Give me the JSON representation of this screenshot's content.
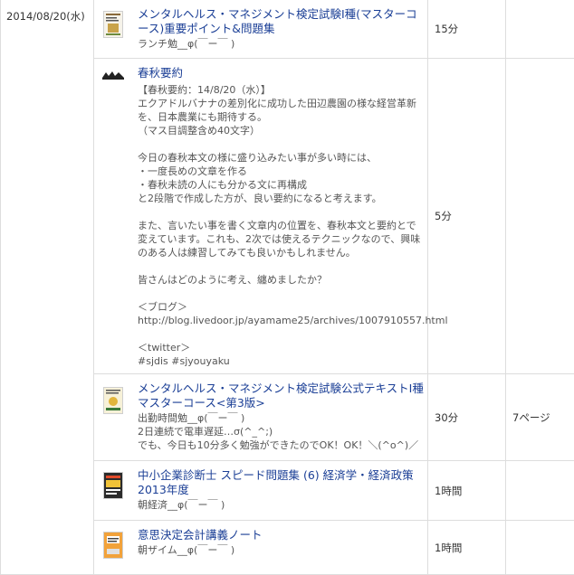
{
  "date": "2014/08/20(水)",
  "rows": [
    {
      "title": "メンタルヘルス・マネジメント検定試験Ⅰ種(マスターコース)重要ポイント&問題集",
      "memo": "ランチ勉__φ(￣ー￣ )",
      "time": "15分",
      "pages": "",
      "thumb_icon": "book-cover-icon"
    },
    {
      "title": "春秋要約",
      "memo": "【春秋要約：14/8/20（水）】\nエクアドルバナナの差別化に成功した田辺農園の様な経営革新を、日本農業にも期待する。\n（マス目調整含め40文字）\n\n今日の春秋本文の様に盛り込みたい事が多い時には、\n・一度長めの文章を作る\n・春秋未読の人にも分かる文に再構成\nと2段階で作成した方が、良い要約になると考えます。\n\nまた、言いたい事を書く文章内の位置を、春秋本文と要約とで変えています。これも、2次では使えるテクニックなので、興味のある人は練習してみても良いかもしれません。\n\n皆さんはどのように考え、纏めましたか？\n\n＜ブログ＞\nhttp://blog.livedoor.jp/ayamame25/archives/1007910557.html\n\n＜twitter＞\n#sjdis #sjyouyaku",
      "time": "5分",
      "pages": "",
      "thumb_icon": "newspaper-logo-icon"
    },
    {
      "title": "メンタルヘルス・マネジメント検定試験公式テキストⅠ種マスターコース<第3版>",
      "memo": "出勤時間勉__φ(￣ー￣ )\n2日連続で電車遅延…σ(^_^;)\nでも、今日も10分多く勉強ができたのでOK！OK！＼(^o^)／",
      "time": "30分",
      "pages": "7ページ",
      "thumb_icon": "book-cover-icon"
    },
    {
      "title": "中小企業診断士 スピード問題集 (6) 経済学・経済政策 2013年度",
      "memo": "朝経済__φ(￣ー￣ )",
      "time": "1時間",
      "pages": "",
      "thumb_icon": "book-cover-icon"
    },
    {
      "title": "意思決定会計講義ノート",
      "memo": "朝ザイム__φ(￣ー￣ )",
      "time": "1時間",
      "pages": "",
      "thumb_icon": "book-cover-icon"
    }
  ]
}
